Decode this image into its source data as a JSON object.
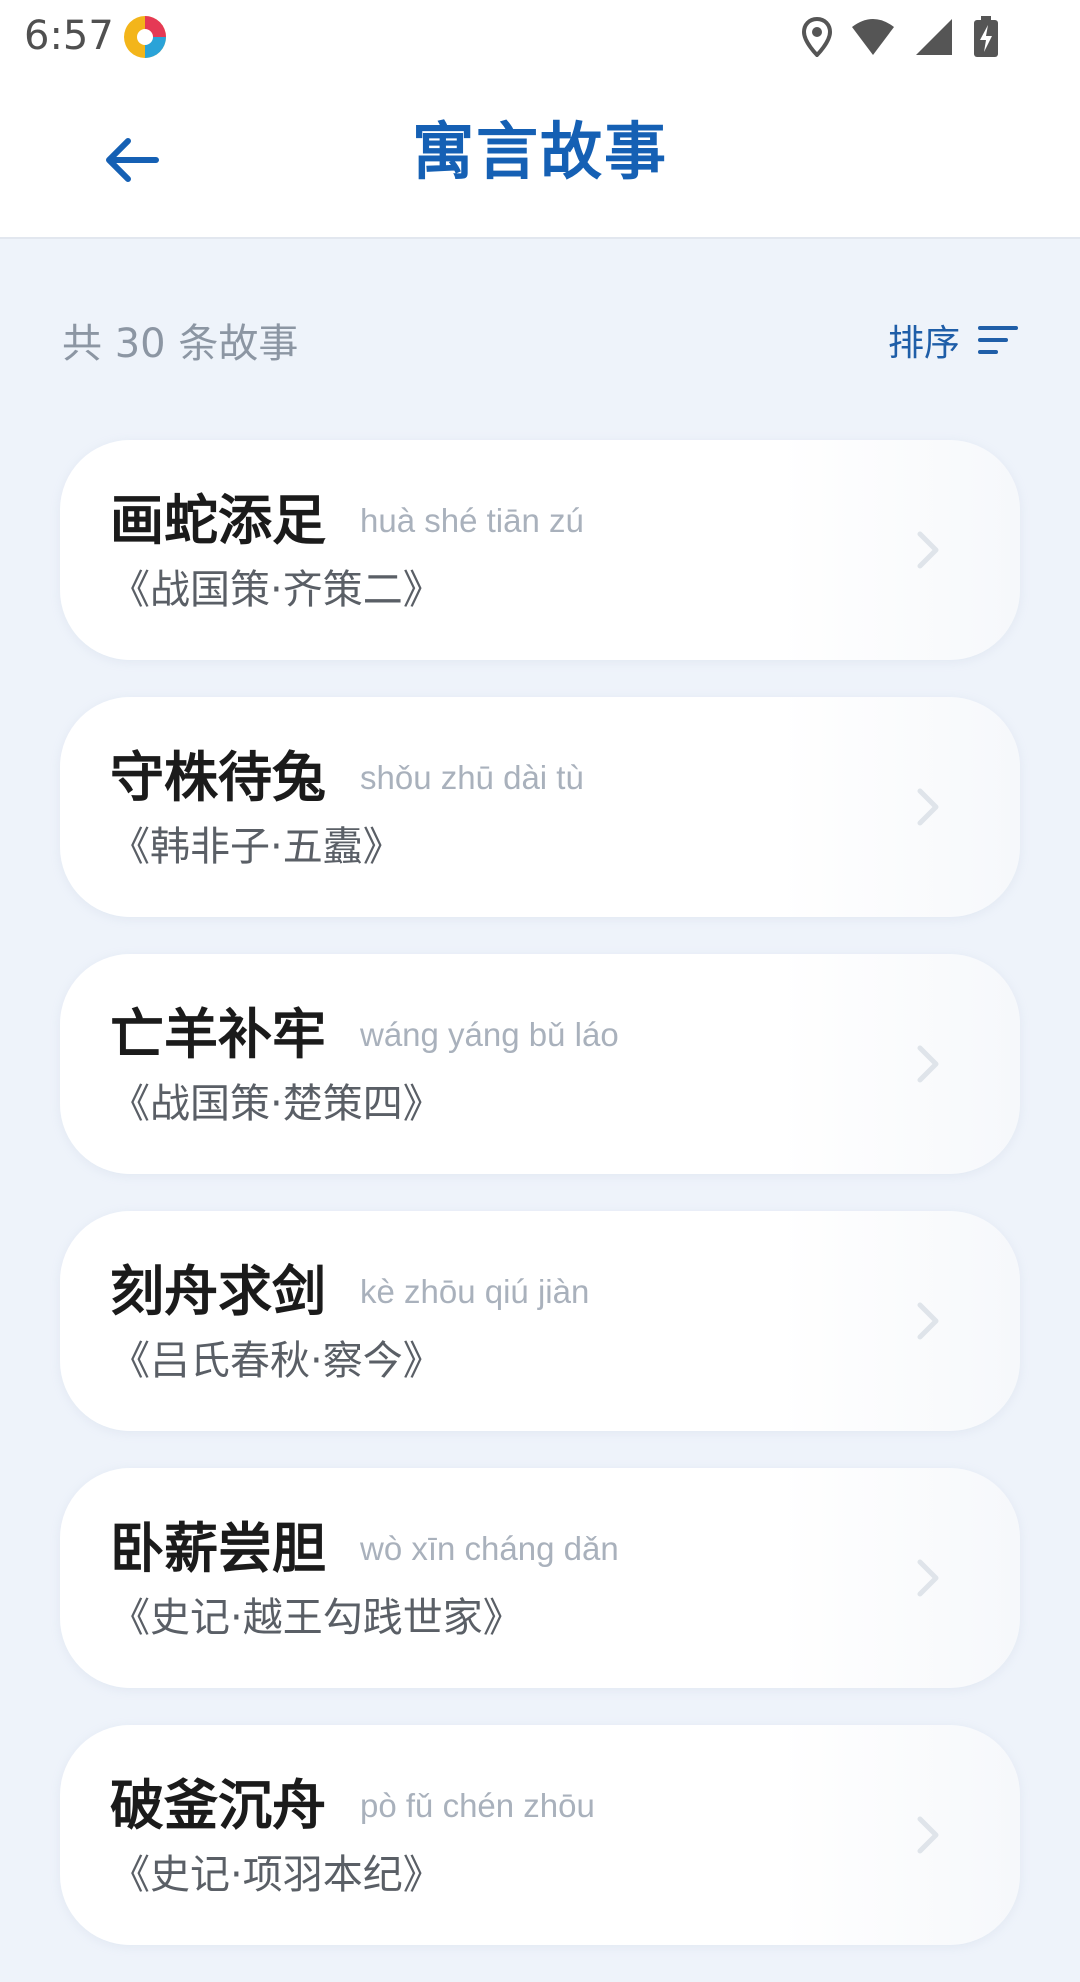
{
  "status_bar": {
    "time": "6:57",
    "icons": [
      "app-badge-icon",
      "location-icon",
      "wifi-icon",
      "signal-icon",
      "battery-charging-icon"
    ]
  },
  "header": {
    "title": "寓言故事",
    "back_icon": "arrow-left-icon"
  },
  "toolbar": {
    "count_text": "共 30 条故事",
    "sort_label": "排序",
    "sort_icon": "sort-lines-icon"
  },
  "colors": {
    "accent": "#1560b4",
    "background": "#eef3fa",
    "card": "#ffffff",
    "muted": "#a9b1bc"
  },
  "stories": [
    {
      "title": "画蛇添足",
      "pinyin": "huà shé tiān zú",
      "source": "《战国策·齐策二》"
    },
    {
      "title": "守株待兔",
      "pinyin": "shǒu zhū dài tù",
      "source": "《韩非子·五蠹》"
    },
    {
      "title": "亡羊补牢",
      "pinyin": "wáng yáng bǔ láo",
      "source": "《战国策·楚策四》"
    },
    {
      "title": "刻舟求剑",
      "pinyin": "kè zhōu qiú jiàn",
      "source": "《吕氏春秋·察今》"
    },
    {
      "title": "卧薪尝胆",
      "pinyin": "wò xīn cháng dǎn",
      "source": "《史记·越王勾践世家》"
    },
    {
      "title": "破釜沉舟",
      "pinyin": "pò fǔ chén zhōu",
      "source": "《史记·项羽本纪》"
    }
  ]
}
